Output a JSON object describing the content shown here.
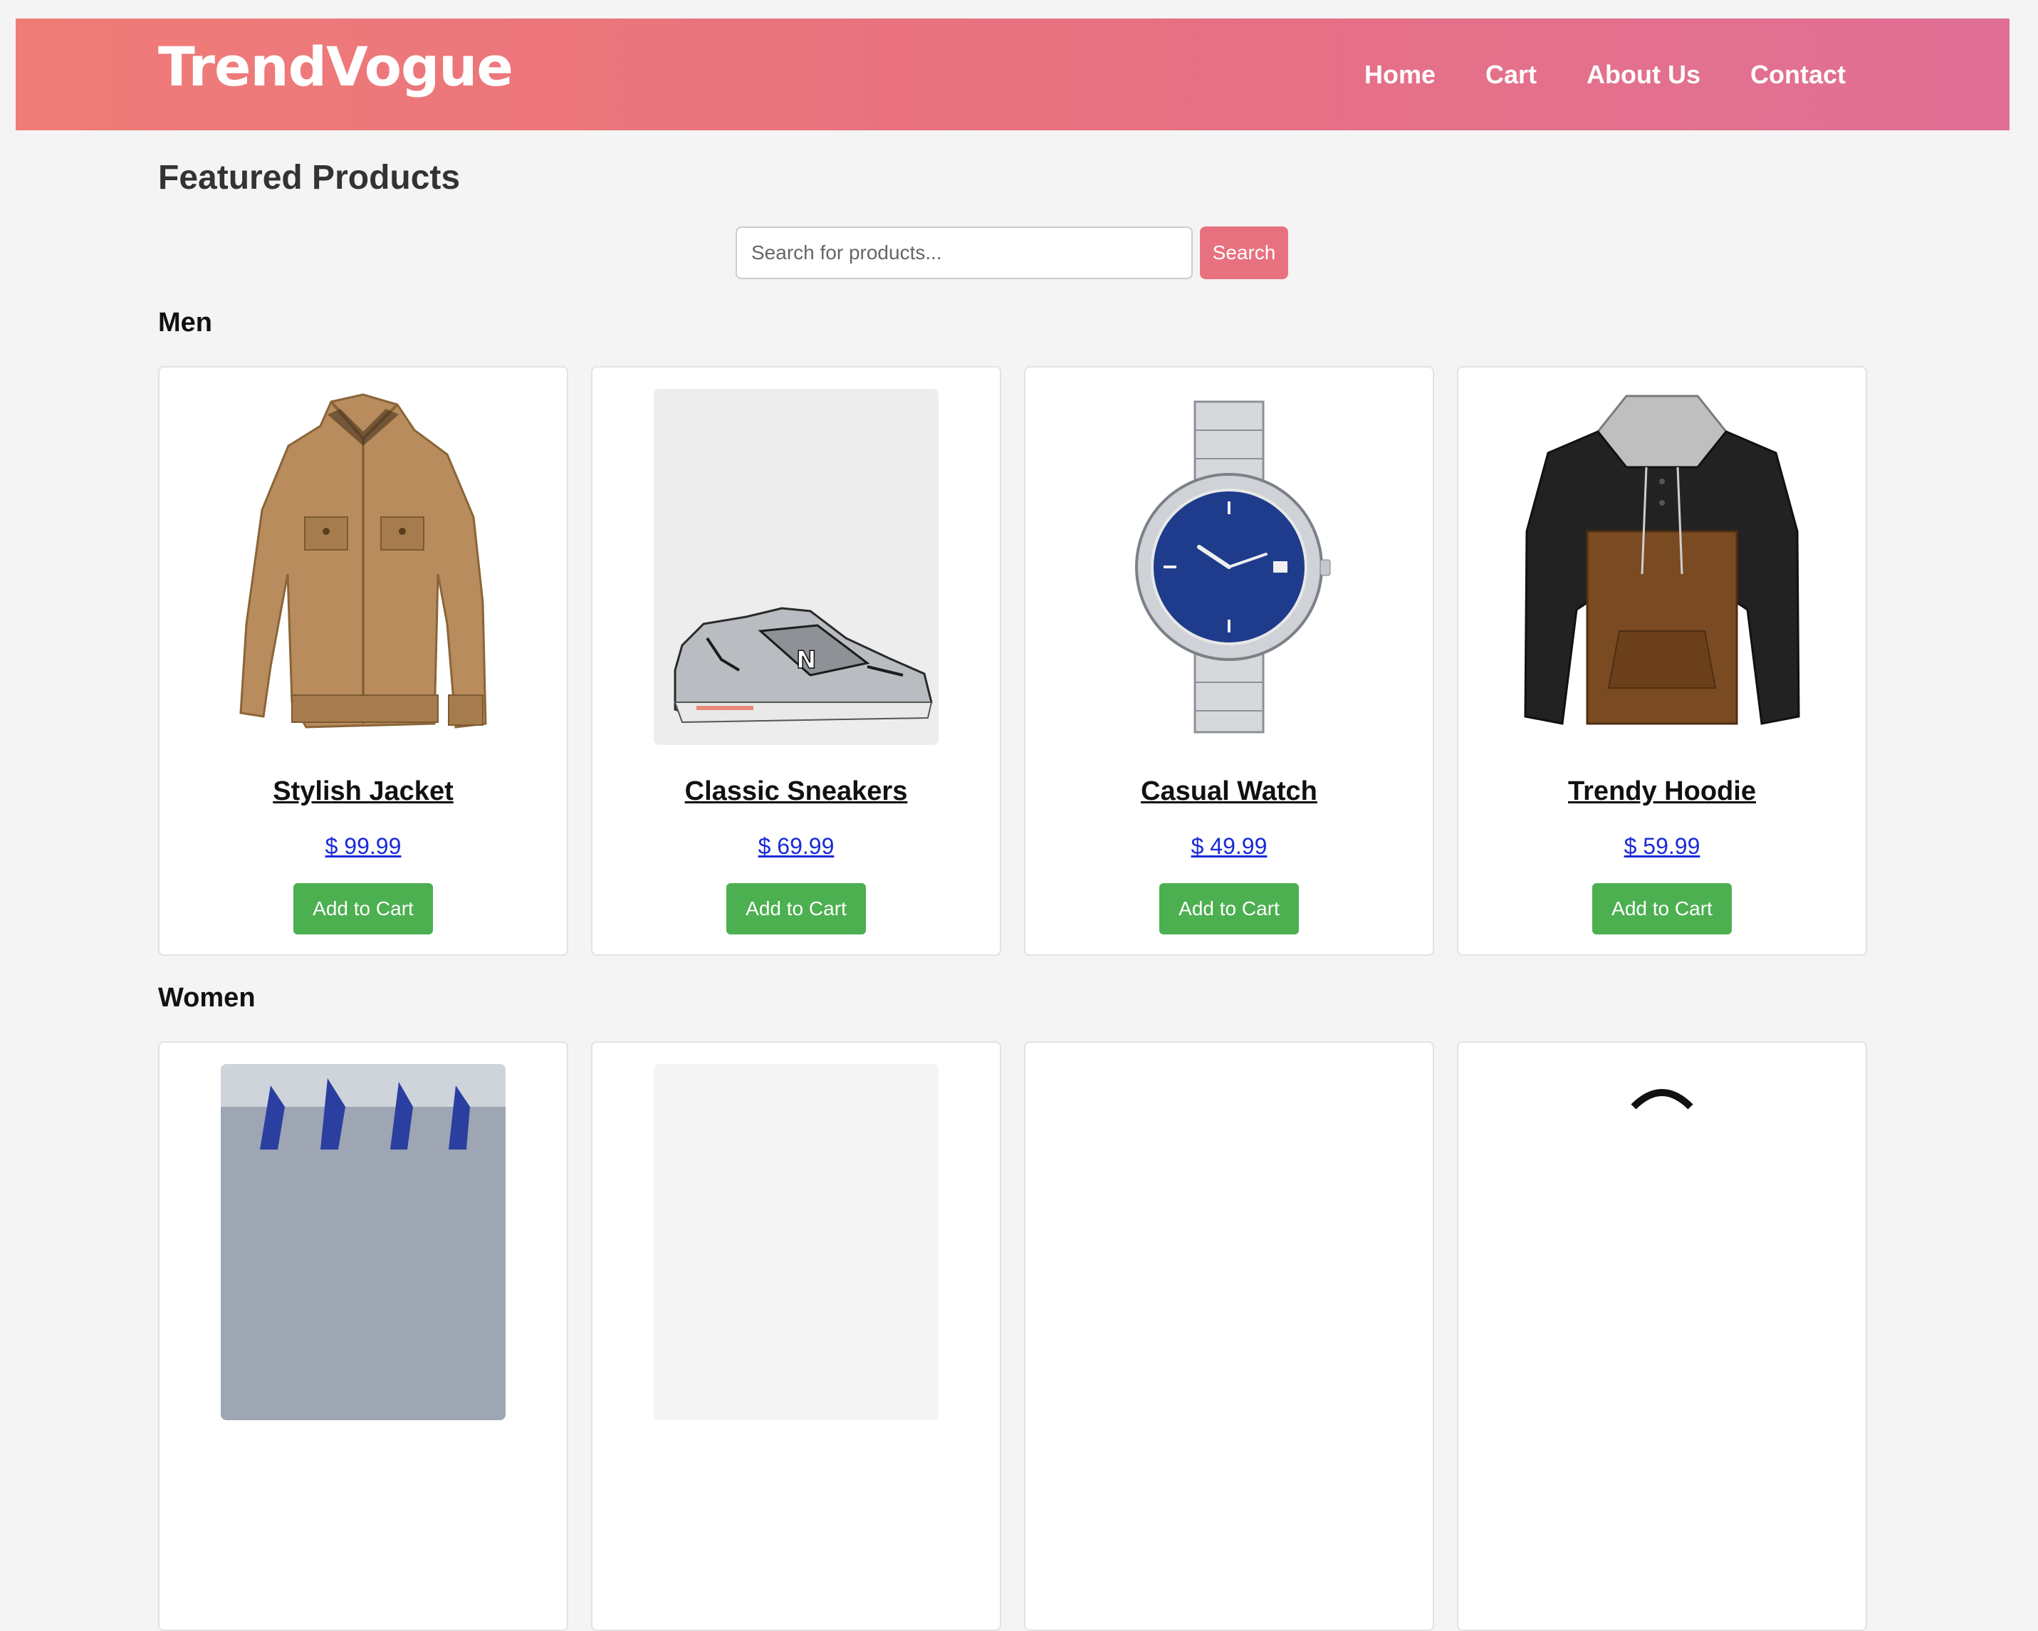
{
  "header": {
    "logo": "TrendVogue",
    "nav": [
      "Home",
      "Cart",
      "About Us",
      "Contact"
    ]
  },
  "page_title": "Featured Products",
  "search": {
    "placeholder": "Search for products...",
    "button_label": "Search"
  },
  "sections": [
    {
      "title": "Men",
      "products": [
        {
          "name": "Stylish Jacket",
          "price": "$ 99.99",
          "button": "Add to Cart",
          "image": "jacket"
        },
        {
          "name": "Classic Sneakers",
          "price": "$ 69.99",
          "button": "Add to Cart",
          "image": "sneakers"
        },
        {
          "name": "Casual Watch",
          "price": "$ 49.99",
          "button": "Add to Cart",
          "image": "watch"
        },
        {
          "name": "Trendy Hoodie",
          "price": "$ 59.99",
          "button": "Add to Cart",
          "image": "hoodie"
        }
      ]
    },
    {
      "title": "Women",
      "products": [
        {
          "image": "dress-photo"
        },
        {
          "image": "placeholder"
        },
        {
          "image": "blank"
        },
        {
          "image": "black-item"
        }
      ]
    }
  ],
  "colors": {
    "header_gradient_start": "#f07c78",
    "header_gradient_end": "#e06f96",
    "accent": "#e8717f",
    "add_button": "#4caf50",
    "price_link": "#1a2bd6",
    "background": "#f4f4f4"
  }
}
